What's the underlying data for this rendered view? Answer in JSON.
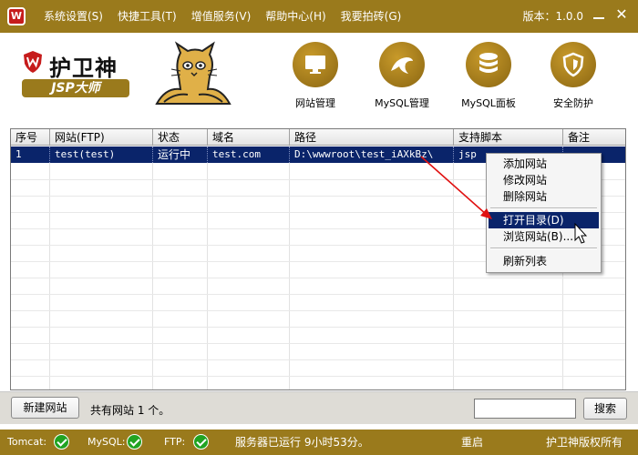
{
  "menu": {
    "items": [
      "系统设置(S)",
      "快捷工具(T)",
      "增值服务(V)",
      "帮助中心(H)",
      "我要拍砖(G)"
    ],
    "version": "版本：1.0.0"
  },
  "brand": {
    "name": "护卫神",
    "subtitle": "JSP大师"
  },
  "toolbar": {
    "site_manage": "网站管理",
    "mysql_manage": "MySQL管理",
    "mysql_panel": "MySQL面板",
    "security": "安全防护"
  },
  "table": {
    "headers": [
      "序号",
      "网站(FTP)",
      "状态",
      "域名",
      "路径",
      "支持脚本",
      "备注"
    ],
    "rows": [
      {
        "index": "1",
        "site": "test(test)",
        "status": "运行中",
        "domain": "test.com",
        "path": "D:\\wwwroot\\test_iAXkBz\\",
        "script": "jsp",
        "note": ""
      }
    ]
  },
  "context_menu": {
    "add": "添加网站",
    "edit": "修改网站",
    "delete": "删除网站",
    "open_dir": "打开目录(D)",
    "browse": "浏览网站(B)...",
    "refresh": "刷新列表"
  },
  "bottom": {
    "new_site": "新建网站",
    "count_text": "共有网站 1 个。",
    "search_value": "",
    "search_button": "搜索"
  },
  "status": {
    "tomcat_label": "Tomcat:",
    "mysql_label": "MySQL:",
    "ftp_label": "FTP:",
    "uptime": "服务器已运行 9小时53分。",
    "restart": "重启",
    "copyright": "护卫神版权所有"
  },
  "colors": {
    "accent": "#9a7a1c",
    "selection": "#0a246a",
    "ok_green": "#21a321"
  }
}
